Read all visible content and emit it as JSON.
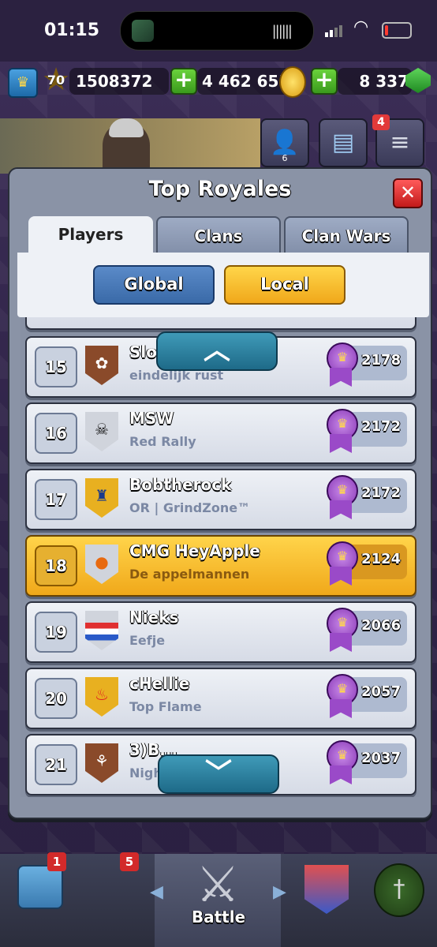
{
  "status_bar": {
    "time": "01:15"
  },
  "resources": {
    "level": "70",
    "trophies": "1508372",
    "gold": "4 462 655",
    "gems": "8 337"
  },
  "header": {
    "social_count": "6",
    "menu_badge": "4"
  },
  "panel": {
    "title": "Top Royales",
    "tabs": [
      "Players",
      "Clans",
      "Clan Wars"
    ],
    "active_tab": "Players",
    "filters": {
      "global": "Global",
      "local": "Local",
      "selected": "Local"
    }
  },
  "rankings": [
    {
      "rank": "15",
      "name": "Slow",
      "clan": "eindelijk rust",
      "trophies": "2178",
      "badge_icon": "lotus-icon",
      "badge_color": "#8a4a2a"
    },
    {
      "rank": "16",
      "name": "MSW",
      "clan": "Red Rally",
      "trophies": "2172",
      "badge_icon": "skull-icon",
      "badge_color": "#d0d4dc"
    },
    {
      "rank": "17",
      "name": "Bobtherock",
      "clan": "OR | GrindZone™",
      "trophies": "2172",
      "badge_icon": "tower-icon",
      "badge_color": "#e8b020"
    },
    {
      "rank": "18",
      "name": "CMG HeyApple",
      "clan": "De appelmannen",
      "trophies": "2124",
      "badge_icon": "peach-icon",
      "badge_color": "#d0d4dc",
      "is_player": true
    },
    {
      "rank": "19",
      "name": "Nieks",
      "clan": "Eefje",
      "trophies": "2066",
      "badge_icon": "flag-icon",
      "badge_color": "#d0d4dc"
    },
    {
      "rank": "20",
      "name": "cHellie",
      "clan": "Top Flame",
      "trophies": "2057",
      "badge_icon": "flame-icon",
      "badge_color": "#e8b020"
    },
    {
      "rank": "21",
      "name": "3)B...",
      "clan": "Nigh...",
      "trophies": "2037",
      "badge_icon": "bamboo-icon",
      "badge_color": "#8a4a2a"
    }
  ],
  "bottom_nav": {
    "chest_badge": "1",
    "cards_badge": "5",
    "battle_label": "Battle"
  }
}
